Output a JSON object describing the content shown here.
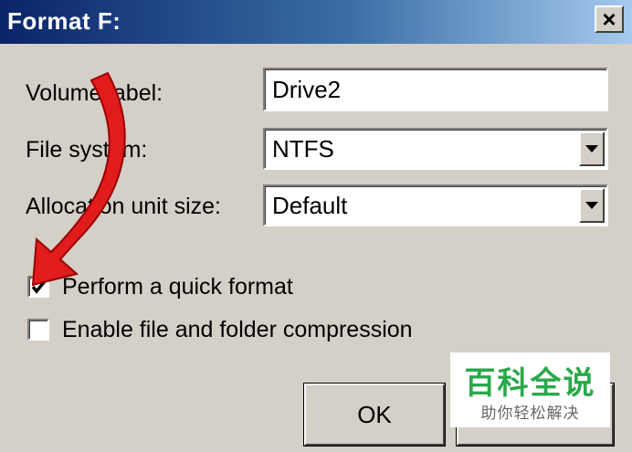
{
  "window": {
    "title": "Format F:",
    "close_glyph": "×"
  },
  "form": {
    "volume_label": {
      "label": "Volume label:",
      "value": "Drive2"
    },
    "file_system": {
      "label": "File system:",
      "value": "NTFS"
    },
    "allocation_unit_size": {
      "label": "Allocation unit size:",
      "value": "Default"
    }
  },
  "options": {
    "quick_format": {
      "label": "Perform a quick format",
      "checked": true
    },
    "compression": {
      "label": "Enable file and folder compression",
      "checked": false
    }
  },
  "buttons": {
    "ok": "OK"
  },
  "watermark": {
    "main": "百科全说",
    "sub": "助你轻松解决"
  },
  "colors": {
    "titlebar_start": "#0a246a",
    "titlebar_end": "#a6caf0",
    "arrow": "#e01c1c",
    "watermark_text": "#2aa84a"
  }
}
